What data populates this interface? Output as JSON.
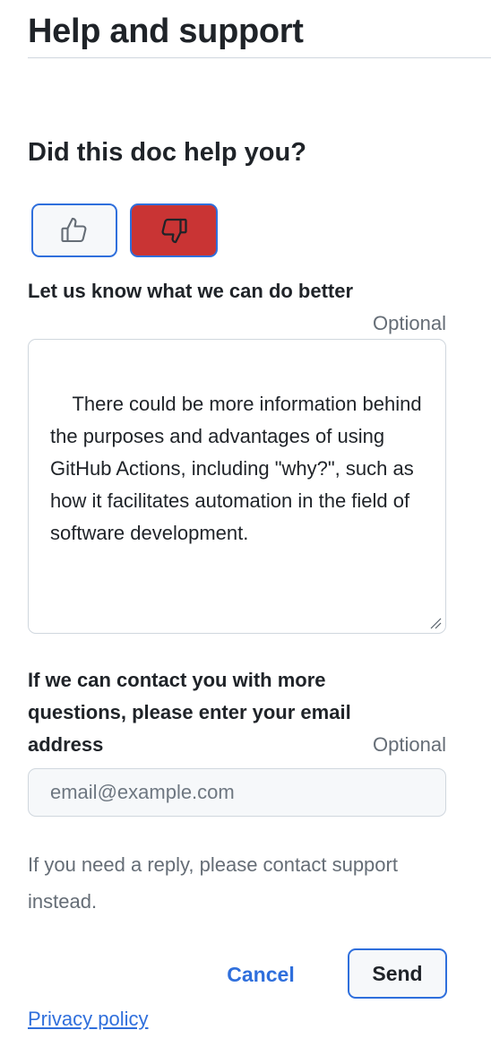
{
  "header": {
    "title": "Help and support"
  },
  "feedback": {
    "question": "Did this doc help you?",
    "thumbs_up": {
      "icon": "thumbs-up-icon",
      "selected": false
    },
    "thumbs_down": {
      "icon": "thumbs-down-icon",
      "selected": true,
      "selected_color": "#c93434"
    },
    "comment_label": "Let us know what we can do better",
    "comment_optional": "Optional",
    "comment_value": "There could be more information behind the purposes and advantages of using GitHub Actions, including \"why?\", such as how it facilitates automation in the field of software development.",
    "email_label": "If we can contact you with more questions, please enter your email address",
    "email_optional": "Optional",
    "email_value": "",
    "email_placeholder": "email@example.com",
    "note": "If you need a reply, please contact support instead.",
    "cancel_label": "Cancel",
    "send_label": "Send"
  },
  "footer": {
    "privacy_link": "Privacy policy"
  },
  "colors": {
    "accent": "#2f6fdc",
    "danger": "#c93434",
    "muted_text": "#656d76",
    "border": "#d0d7de"
  }
}
